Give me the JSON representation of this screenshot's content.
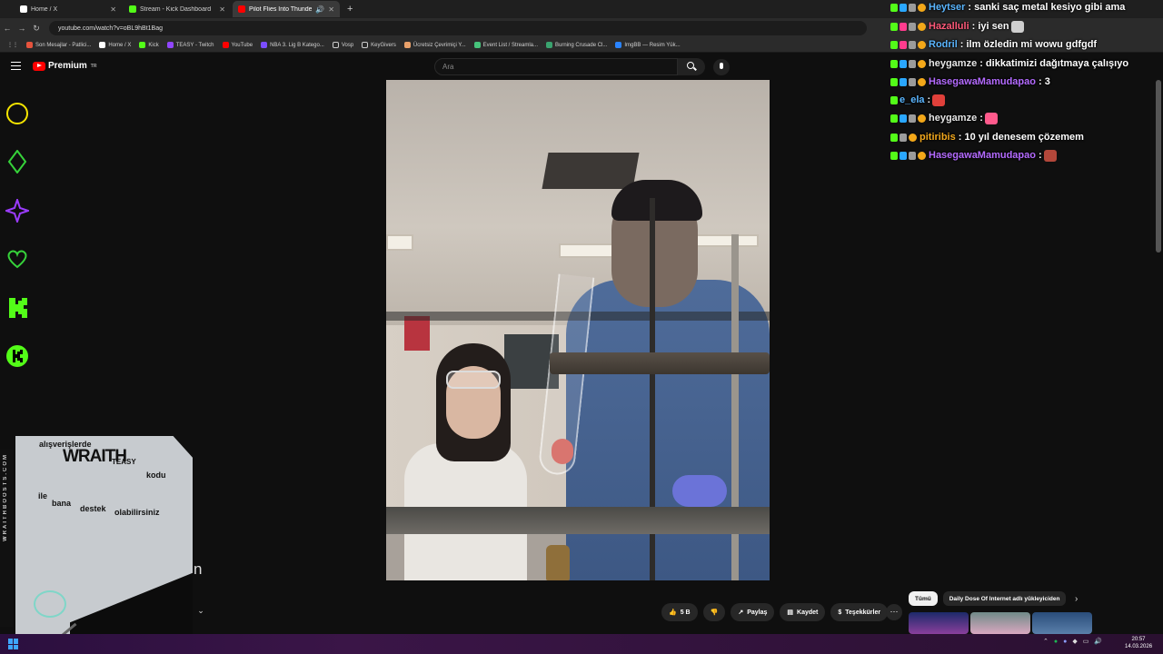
{
  "browser": {
    "tabs": [
      {
        "title": "Home / X",
        "active": false,
        "favicon_color": "#ffffff"
      },
      {
        "title": "Stream - Kick Dashboard",
        "active": false,
        "favicon_color": "#53fc18"
      },
      {
        "title": "Pilot Flies Into Thunderstorm",
        "active": true,
        "favicon_color": "#ff0000"
      }
    ],
    "new_tab_symbol": "+",
    "url": "youtube.com/watch?v=oBL9hBt1Bag",
    "bookmarks": [
      {
        "label": "Son Mesajlar - Patlici...",
        "color": "#e5533d"
      },
      {
        "label": "Home / X",
        "color": "#ffffff"
      },
      {
        "label": "Kick",
        "color": "#53fc18"
      },
      {
        "label": "TEASY - Twitch",
        "color": "#9146ff"
      },
      {
        "label": "YouTube",
        "color": "#ff0000"
      },
      {
        "label": "NBA 3. Lig B Katego...",
        "color": "#7b4dff"
      },
      {
        "label": "Vosp",
        "color": "#cccccc"
      },
      {
        "label": "KeyGivers",
        "color": "#cccccc"
      },
      {
        "label": "Ücretsiz Çevrimiçi Y...",
        "color": "#e8a06a"
      },
      {
        "label": "Event List / Streamla...",
        "color": "#46c37b"
      },
      {
        "label": "Burning Crusade Cl...",
        "color": "#3aa36f"
      },
      {
        "label": "ImgBB — Resim Yük...",
        "color": "#2a84ff"
      }
    ]
  },
  "youtube": {
    "logo_text": "Premium",
    "logo_region": "TR",
    "search_placeholder": "Ara"
  },
  "sponsor": {
    "words": [
      "alışverişlerde",
      "WRAITH",
      "TEASY",
      "kodu",
      "ile",
      "bana",
      "destek",
      "olabilirsiniz"
    ],
    "vertical_text": "WRAITHBOOSTS.COM"
  },
  "subtitle_fragment": "n",
  "actions": {
    "like_count": "5 B",
    "share_label": "Paylaş",
    "save_label": "Kaydet",
    "thanks_label": "Teşekkürler",
    "more_symbol": "⋯"
  },
  "chat": {
    "messages": [
      {
        "user": "Heytser",
        "user_color": "#5bb6ff",
        "text": ": sanki saç metal kesiyo gibi ama"
      },
      {
        "user": "Hazalluli",
        "user_color": "#ff5a7a",
        "text": ": iyi sen"
      },
      {
        "user": "Rodril",
        "user_color": "#5bb6ff",
        "text": ": ilm özledin mi wowu gdfgdf"
      },
      {
        "user": "heygamze",
        "user_color": "#e6e6e6",
        "text": ": dikkatimizi dağıtmaya çalışıyo"
      },
      {
        "user": "HasegawaMamudapao",
        "user_color": "#b46bff",
        "text": ": 3"
      },
      {
        "user": "e_ela",
        "user_color": "#5bb6ff",
        "text": ":"
      },
      {
        "user": "heygamze",
        "user_color": "#e6e6e6",
        "text": ":"
      },
      {
        "user": "pitiribis",
        "user_color": "#f2a81d",
        "text": ": 10 yıl denesem çözemem"
      },
      {
        "user": "HasegawaMamudapao",
        "user_color": "#b46bff",
        "text": ":"
      }
    ]
  },
  "recommendations": {
    "chips": [
      "Tümü",
      "Daily Dose Of Internet adlı yükleyiciden"
    ],
    "next_symbol": "›"
  },
  "taskbar": {
    "time": "20:57",
    "date": "14.03.2026"
  }
}
